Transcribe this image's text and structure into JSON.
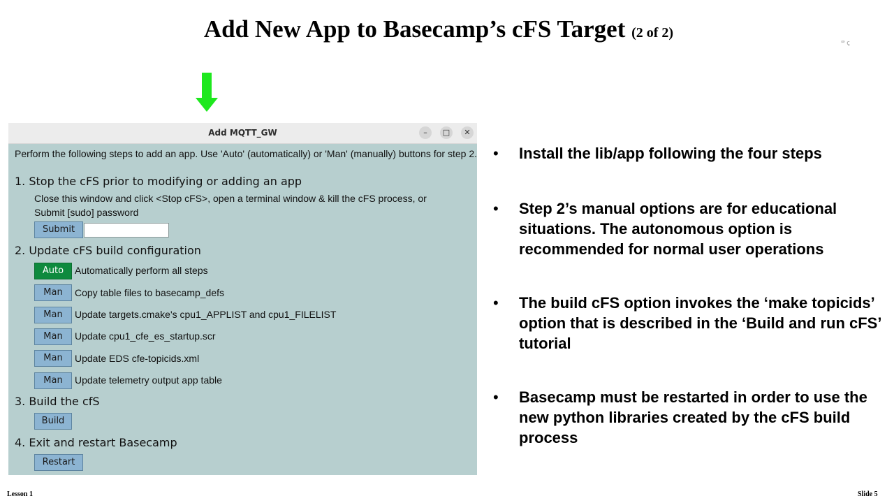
{
  "slide": {
    "title": "Add New App to Basecamp’s cFS Target",
    "title_suffix": "(2 of 2)",
    "corner_mark": "ꟹ ꞔ",
    "footer_left": "Lesson 1",
    "footer_right": "Slide 5",
    "arrow_color": "#1ee81e"
  },
  "window": {
    "title": "Add MQTT_GW",
    "controls": {
      "minimize": "–",
      "maximize": "□",
      "close": "✕"
    },
    "intro": "Perform the following steps to add an app. Use 'Auto' (automatically) or 'Man' (manually) buttons for step 2.",
    "step1": {
      "heading": "1. Stop the cFS prior to modifying or adding an app",
      "note_line1": "Close this window and click <Stop cFS>, open a terminal window & kill the cFS process, or",
      "note_line2": "Submit [sudo] password",
      "submit_label": "Submit",
      "password_value": ""
    },
    "step2": {
      "heading": "2. Update cFS build configuration",
      "rows": [
        {
          "button": "Auto",
          "label": "Automatically perform all steps"
        },
        {
          "button": "Man",
          "label": "Copy table files to basecamp_defs"
        },
        {
          "button": "Man",
          "label": "Update targets.cmake's cpu1_APPLIST and cpu1_FILELIST"
        },
        {
          "button": "Man",
          "label": "Update cpu1_cfe_es_startup.scr"
        },
        {
          "button": "Man",
          "label": "Update EDS cfe-topicids.xml"
        },
        {
          "button": "Man",
          "label": "Update telemetry output app table"
        }
      ]
    },
    "step3": {
      "heading": "3. Build the cfS",
      "button": "Build"
    },
    "step4": {
      "heading": "4. Exit and restart Basecamp",
      "button": "Restart"
    },
    "colors": {
      "background": "#b7cfcf",
      "button": "#8cb4d2",
      "auto_button": "#0e8a3e"
    }
  },
  "bullets": {
    "bullet_char": "•",
    "items": [
      {
        "text": "Install the lib/app following the four steps"
      },
      {
        "text": "Step 2’s manual options are for educational situations. The autonomous option is recommended for normal user operations"
      },
      {
        "text": "The build cFS option invokes the ‘make topicids’ option that is described in the ‘Build and run cFS’ tutorial"
      },
      {
        "text": "Basecamp must be restarted in order to use the new python libraries created by the cFS build process"
      }
    ]
  }
}
